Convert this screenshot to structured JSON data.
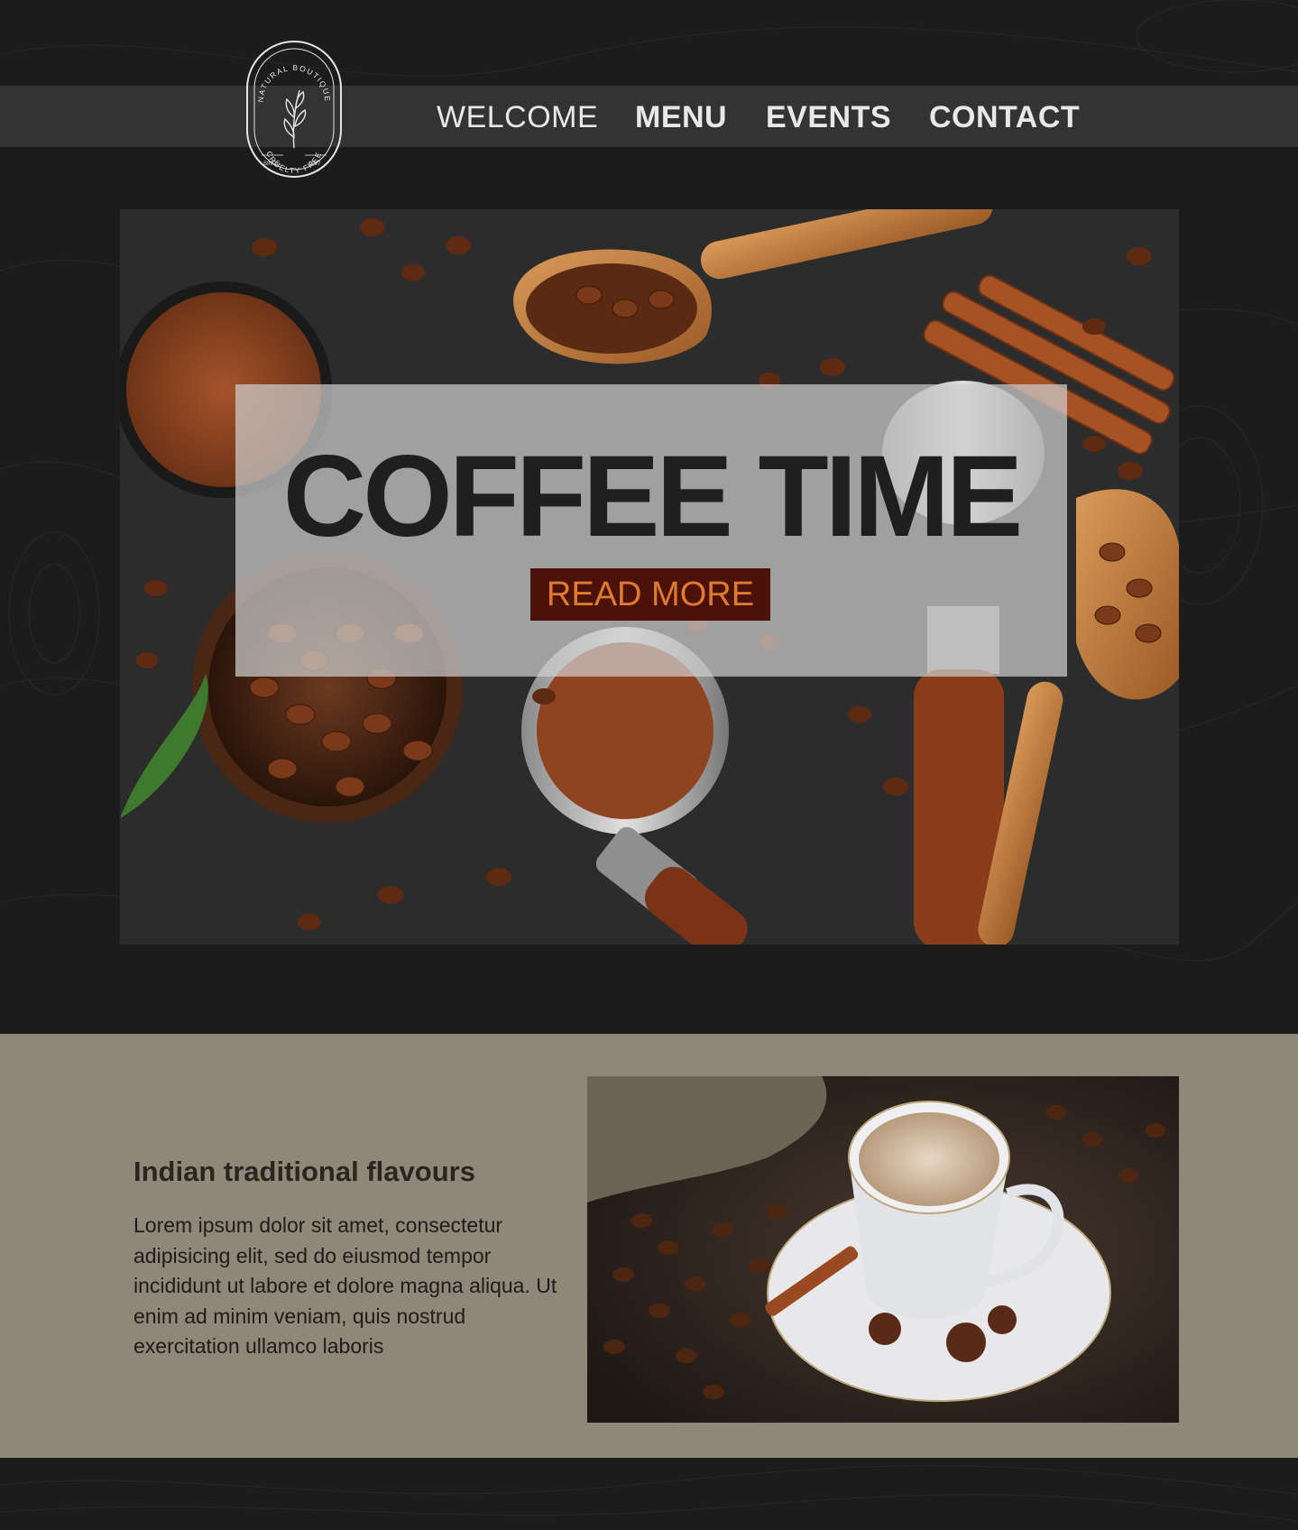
{
  "logo": {
    "top_text": "NATURAL BOUTIQUE",
    "since_label": "SINCE",
    "year": "1997",
    "bottom_text": "CRUELTY FREE"
  },
  "nav": {
    "items": [
      {
        "label": "WELCOME"
      },
      {
        "label": "MENU"
      },
      {
        "label": "EVENTS"
      },
      {
        "label": "CONTACT"
      }
    ]
  },
  "hero": {
    "title": "COFFEE TIME",
    "button_label": "READ MORE"
  },
  "feature": {
    "heading": "Indian traditional flavours",
    "body": "Lorem ipsum dolor sit amet, consectetur adipisicing elit, sed do eiusmod tempor incididunt ut labore et dolore magna aliqua. Ut enim ad minim veniam, quis nostrud exercitation ullamco laboris"
  },
  "colors": {
    "page_bg": "#1c1c1c",
    "nav_text": "#e8e8e8",
    "button_bg": "#4a1208",
    "button_text": "#e07a2f",
    "section_bg": "#8f877a",
    "heading_text": "#2a251f"
  }
}
